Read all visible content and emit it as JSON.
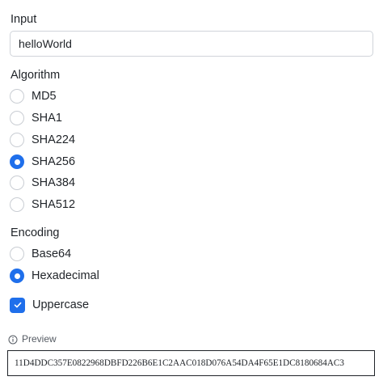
{
  "input": {
    "label": "Input",
    "value": "helloWorld"
  },
  "algorithm": {
    "label": "Algorithm",
    "options": [
      "MD5",
      "SHA1",
      "SHA224",
      "SHA256",
      "SHA384",
      "SHA512"
    ],
    "selected": "SHA256"
  },
  "encoding": {
    "label": "Encoding",
    "options": [
      "Base64",
      "Hexadecimal"
    ],
    "selected": "Hexadecimal"
  },
  "uppercase": {
    "label": "Uppercase",
    "checked": true
  },
  "preview": {
    "label": "Preview",
    "icon": "info-icon",
    "value": "11D4DDC357E0822968DBFD226B6E1C2AAC018D076A54DA4F65E1DC8180684AC3"
  },
  "colors": {
    "accent": "#1f6feb",
    "text": "#1f2328",
    "border": "#d0d4da"
  }
}
